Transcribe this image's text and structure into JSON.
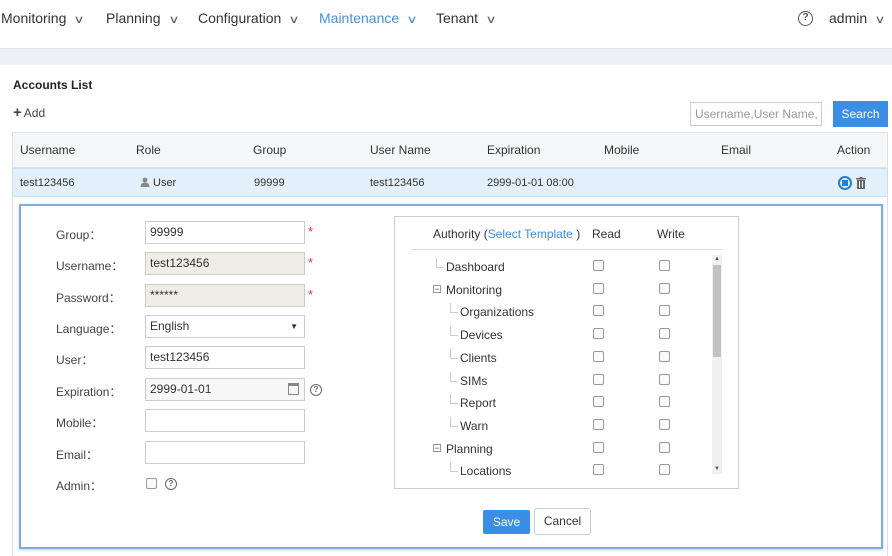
{
  "nav": {
    "items": [
      {
        "label": "Monitoring"
      },
      {
        "label": "Planning"
      },
      {
        "label": "Configuration"
      },
      {
        "label": "Maintenance"
      },
      {
        "label": "Tenant"
      }
    ],
    "help_glyph": "?",
    "user_label": "admin"
  },
  "page": {
    "title": "Accounts List",
    "add_label": "Add",
    "search_placeholder": "Username,User Name,Mobile",
    "search_button": "Search"
  },
  "table": {
    "columns": [
      "Username",
      "Role",
      "Group",
      "User Name",
      "Expiration",
      "Mobile",
      "Email",
      "Action"
    ],
    "rows": [
      {
        "username": "test123456",
        "role": "User",
        "group": "99999",
        "user_name": "test123456",
        "expiration": "2999-01-01 08:00",
        "mobile": "",
        "email": ""
      }
    ]
  },
  "form": {
    "group_label": "Group：",
    "group_value": "99999",
    "username_label": "Username：",
    "username_value": "test123456",
    "password_label": "Password：",
    "password_value": "******",
    "language_label": "Language：",
    "language_value": "English",
    "user_label": "User：",
    "user_value": "test123456",
    "expiration_label": "Expiration：",
    "expiration_value": "2999-01-01",
    "mobile_label": "Mobile：",
    "mobile_value": "",
    "email_label": "Email：",
    "email_value": "",
    "admin_label": "Admin：",
    "required_mark": "*",
    "help_glyph": "?"
  },
  "authority": {
    "header_prefix": "Authority (",
    "select_template": "Select Template",
    "header_suffix": " )",
    "read_label": "Read",
    "write_label": "Write",
    "tree": [
      {
        "label": "Dashboard",
        "level": 0,
        "expander": ""
      },
      {
        "label": "Monitoring",
        "level": 0,
        "expander": "⊟"
      },
      {
        "label": "Organizations",
        "level": 1,
        "expander": ""
      },
      {
        "label": "Devices",
        "level": 1,
        "expander": ""
      },
      {
        "label": "Clients",
        "level": 1,
        "expander": ""
      },
      {
        "label": "SIMs",
        "level": 1,
        "expander": ""
      },
      {
        "label": "Report",
        "level": 1,
        "expander": ""
      },
      {
        "label": "Warn",
        "level": 1,
        "expander": ""
      },
      {
        "label": "Planning",
        "level": 0,
        "expander": "⊟"
      },
      {
        "label": "Locations",
        "level": 1,
        "expander": ""
      }
    ]
  },
  "buttons": {
    "save": "Save",
    "cancel": "Cancel"
  },
  "colors": {
    "accent": "#3a8ee6",
    "active_nav": "#4a90d9",
    "row_highlight": "#e3effa",
    "required": "#ee3333"
  }
}
